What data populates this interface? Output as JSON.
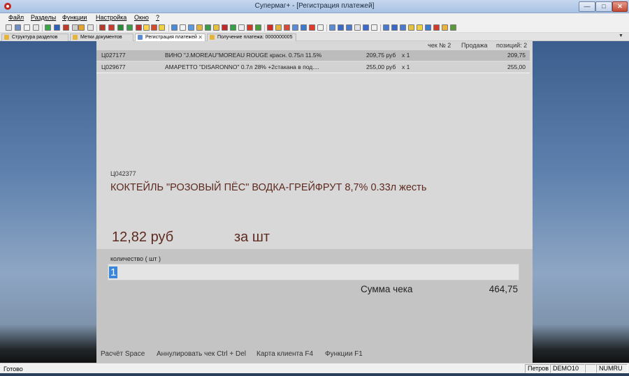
{
  "window": {
    "title": "Супермаг+  - [Регистрация платежей]",
    "min": "—",
    "max": "□",
    "close": "✕"
  },
  "menu": [
    "Файл",
    "Разделы",
    "Функции",
    "Настройка",
    "Окно",
    "?"
  ],
  "tabs": [
    {
      "label": "Структура разделов",
      "close": ""
    },
    {
      "label": "Метки документов",
      "close": ""
    },
    {
      "label": "Регистрация платежей",
      "close": "✕"
    },
    {
      "label": "Получение платежа: 0000000005",
      "close": ""
    }
  ],
  "tab_dropdown": "▼",
  "receipt": {
    "check_no": "чек №  2",
    "mode": "Продажа",
    "positions": "позиций:  2",
    "lines": [
      {
        "code": "Ц027177",
        "name": "ВИНО \"J.MOREAU\"MOREAU ROUGE красн. 0.75л 11.5%",
        "price": "209,75 руб",
        "qty": "x 1",
        "sum": "209,75"
      },
      {
        "code": "Ц029677",
        "name": "AMAPETTO \"DISARONNO\"  0.7л 28% +2стакана в под....",
        "price": "255,00 руб",
        "qty": "x 1",
        "sum": "255,00"
      }
    ]
  },
  "current_item": {
    "code": "Ц042377",
    "name": "КОКТЕЙЛЬ \"РОЗОВЫЙ ПЁС\" ВОДКА-ГРЕЙФРУТ 8,7% 0.33л жесть",
    "price": "12,82 руб",
    "unit": "за шт"
  },
  "quantity": {
    "label": "количество ( шт )",
    "value": "1"
  },
  "total": {
    "label": "Сумма чека",
    "value": "464,75"
  },
  "hotkeys": [
    "Расчёт Space",
    "Аннулировать чек Ctrl + Del",
    "Карта клиента F4",
    "Функции F1"
  ],
  "status": {
    "text": "Готово",
    "user": "Петров",
    "db": "DEMO10",
    "empty": "",
    "numlock": "NUMRU"
  },
  "colors": {
    "accent_text": "#5e2a20",
    "selection": "#3b86d8",
    "panel": "#d8d8d8",
    "panel_lower": "#c4c4c4"
  }
}
